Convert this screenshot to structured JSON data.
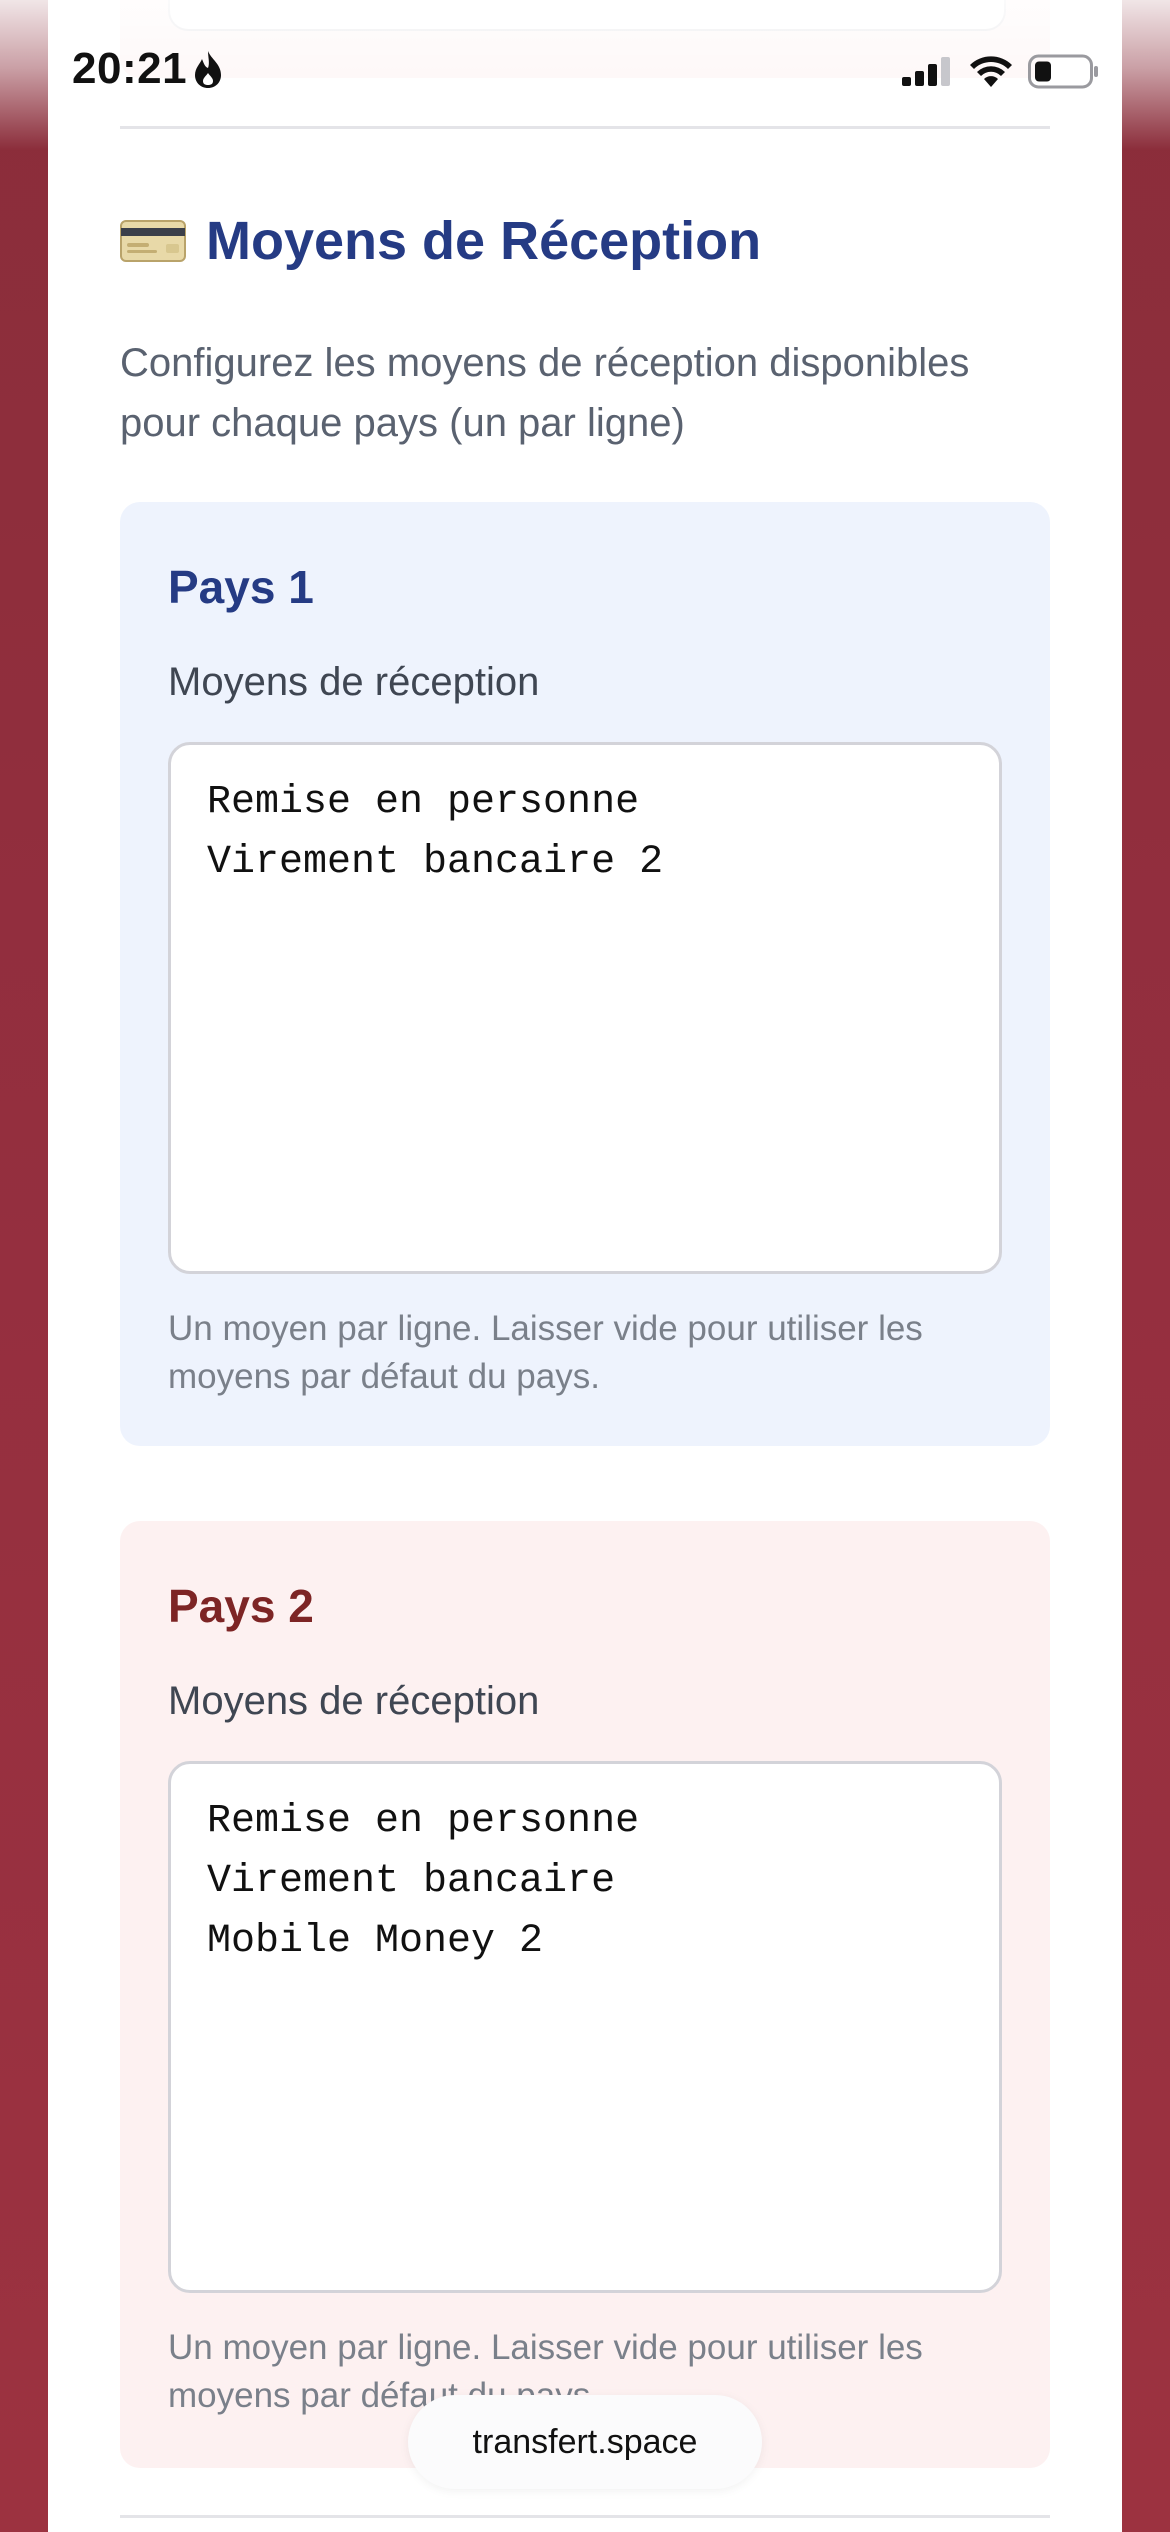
{
  "status_bar": {
    "time": "20:21",
    "icons": [
      "flame-icon",
      "signal-icon",
      "wifi-icon",
      "battery-icon"
    ]
  },
  "section": {
    "icon": "credit-card-icon",
    "title": "Moyens de Réception",
    "description": "Configurez les moyens de réception disponibles pour chaque pays (un par ligne)"
  },
  "countries": [
    {
      "title": "Pays 1",
      "field_label": "Moyens de réception",
      "value": "Remise en personne\nVirement bancaire 2",
      "hint": "Un moyen par ligne. Laisser vide pour utiliser les moyens par défaut du pays.",
      "accent": "#253b84",
      "background": "#eef3fd"
    },
    {
      "title": "Pays 2",
      "field_label": "Moyens de réception",
      "value": "Remise en personne\nVirement bancaire\nMobile Money 2",
      "hint": "Un moyen par ligne. Laisser vide pour utiliser les moyens par défaut du pays.",
      "accent": "#7d2525",
      "background": "#fdf1f1"
    }
  ],
  "browser": {
    "url": "transfert.space"
  }
}
